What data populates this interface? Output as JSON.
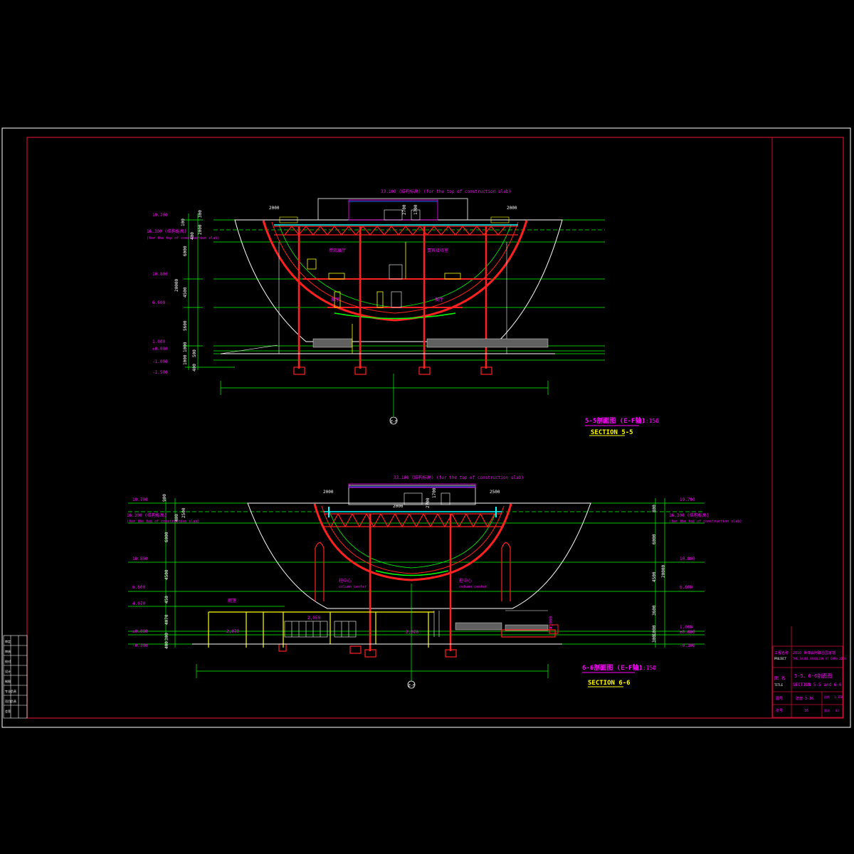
{
  "colors": {
    "background": "#000000",
    "frame": "#ffffff",
    "border": "#c8102e",
    "structure": "#ff2020",
    "grid": "#00ff00",
    "magenta": "#ff00ff",
    "yellow": "#ffff00",
    "cyan": "#00ffff",
    "white": "#ffffff",
    "blue": "#3060ff",
    "gray": "#808080"
  },
  "section_5": {
    "title_cn": "5-5剖面图 (E-F轴)",
    "scale": "1:150",
    "title_en": "SECTION 5-5",
    "top_note": "33.100 (结构标高)  (for the top of construction slab)",
    "dim_left": "2000",
    "dim_right": "2000",
    "dim_mid": "2700",
    "dim_mid2": "1700",
    "levels_left": [
      "19.700",
      "10.800",
      "6.600",
      "1.000",
      "±0.000",
      "-1.000",
      "-1.500"
    ],
    "level_note": "16.300 (结构标高)",
    "level_note_en": "(for the top of construction slab)",
    "vertical_dims": [
      "300",
      "100",
      "2000",
      "400",
      "6000",
      "20000",
      "4500",
      "5600",
      "1000",
      "500",
      "1000",
      "400"
    ],
    "room_labels": [
      "参观展厅",
      "贵宾接待室",
      "展厅",
      "展厅"
    ],
    "axis_label": "E-F"
  },
  "section_6": {
    "title_cn": "6-6剖面图 (E-F轴)",
    "scale": "1:150",
    "title_en": "SECTION 6-6",
    "top_note": "33.100 (结构标高)  (for the top of construction slab)",
    "dim_left": "2000",
    "dim_right": "2500",
    "dim_mid": "2700",
    "dim_mid2": "1700",
    "center_dim": "2000",
    "levels_left": [
      "19.700",
      "10.800",
      "6.600",
      "4.070",
      "±0.000",
      "-0.300"
    ],
    "levels_right": [
      "19.700",
      "10.800",
      "6.600",
      "1.000",
      "±0.000",
      "-0.300"
    ],
    "level_note_left": "16.300 (结构标高)",
    "level_note_right": "16.300 (结构标高)",
    "level_note_en": "(for the top of construction slab)",
    "vertical_dims_left": [
      "900",
      "2500",
      "400",
      "6000",
      "4500",
      "450",
      "4070",
      "300",
      "400"
    ],
    "vertical_dims_right": [
      "800",
      "6000",
      "20000",
      "4500",
      "3600",
      "1000",
      "300"
    ],
    "column_labels": [
      "柱中心",
      "column center",
      "柱中心",
      "column center"
    ],
    "canopy_label": "雨篷",
    "small_dims": [
      "2,070",
      "2,050",
      "2,070",
      "4,000"
    ],
    "axis_label": "E-F"
  },
  "title_block": {
    "project_label": "工程名称",
    "project_label_en": "PROJECT",
    "project_cn": "2010 世博会阿联酋国家馆",
    "project_en": "THE SAUDI PAVILION AT EXPO 2010",
    "drawing_label": "图 名",
    "drawing_label_en": "TITLE",
    "drawing_cn": "5-5、6-6剖面图",
    "drawing_en": "SECTION 5-5 and 6-6",
    "number_label": "图号",
    "number_value": "建施-3-16",
    "scale_label": "比例",
    "scale_value": "1:150",
    "sheet_label": "张号",
    "sheet_value": "16",
    "edition_label": "版次",
    "edition_value": "02"
  },
  "left_stamp": [
    "审定",
    "审核",
    "校对",
    "设计",
    "制图",
    "专业负责",
    "项目负责",
    "会签"
  ]
}
